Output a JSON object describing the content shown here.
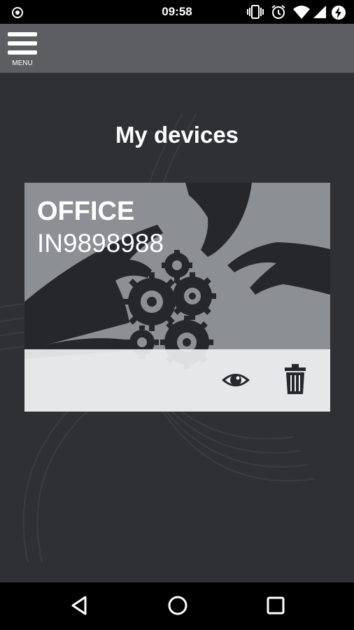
{
  "status_bar": {
    "time": "09:58",
    "icons": [
      "circle-dot-icon",
      "vibrate-icon",
      "alarm-icon",
      "wifi-icon",
      "signal-icon",
      "battery-charging-icon"
    ]
  },
  "app_bar": {
    "menu_label": "MENU",
    "menu_icon": "hamburger-icon"
  },
  "main": {
    "title": "My devices",
    "devices": [
      {
        "name": "OFFICE",
        "id": "IN9898988",
        "actions": [
          {
            "icon": "eye-icon"
          },
          {
            "icon": "trash-icon"
          }
        ]
      }
    ]
  },
  "nav_bar": {
    "buttons": [
      "back-icon",
      "home-icon",
      "recents-icon"
    ]
  },
  "colors": {
    "background": "#2e3033",
    "app_bar": "#5d5e61",
    "card": "#8a8d91",
    "card_action_bar": "#eeeff0",
    "icon_dark": "#25272b",
    "text": "#ffffff"
  }
}
